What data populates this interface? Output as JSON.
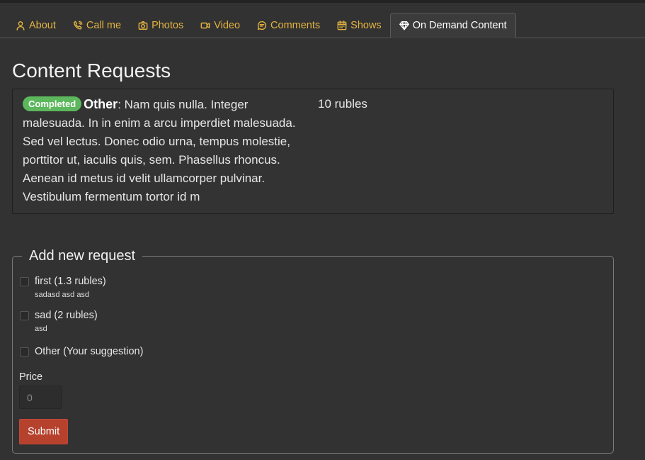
{
  "tabs": [
    {
      "label": "About",
      "icon": "person-icon"
    },
    {
      "label": "Call me",
      "icon": "phone-icon"
    },
    {
      "label": "Photos",
      "icon": "camera-icon"
    },
    {
      "label": "Video",
      "icon": "video-icon"
    },
    {
      "label": "Comments",
      "icon": "comment-icon"
    },
    {
      "label": "Shows",
      "icon": "calendar-icon"
    },
    {
      "label": "On Demand Content",
      "icon": "diamond-icon",
      "active": true
    }
  ],
  "page": {
    "title": "Content Requests"
  },
  "requests": [
    {
      "status": "Completed",
      "type": "Other",
      "separator": ":",
      "text": " Nam quis nulla. Integer malesuada. In in enim a arcu imperdiet malesuada. Sed vel lectus. Donec odio urna, tempus molestie, porttitor ut, iaculis quis, sem. Phasellus rhoncus. Aenean id metus id velit ullamcorper pulvinar. Vestibulum fermentum tortor id m",
      "price": "10 rubles"
    }
  ],
  "form": {
    "legend": "Add new request",
    "options": [
      {
        "label": "first (1.3 rubles)",
        "description": "sadasd asd asd"
      },
      {
        "label": "sad (2 rubles)",
        "description": "asd"
      },
      {
        "label": "Other (Your suggestion)",
        "description": ""
      }
    ],
    "price_label": "Price",
    "price_placeholder": "0",
    "submit_label": "Submit"
  },
  "colors": {
    "accent": "#e3b341",
    "badge": "#5cb85c",
    "submit": "#b6412d"
  }
}
